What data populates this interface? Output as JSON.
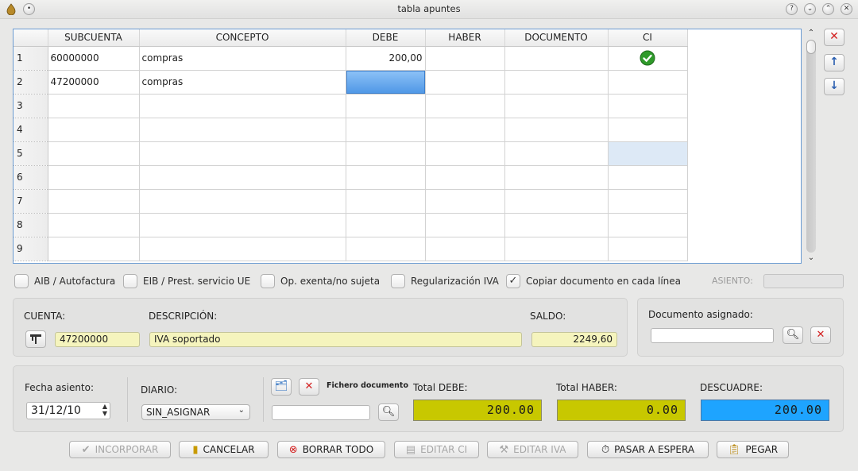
{
  "window": {
    "title": "tabla apuntes"
  },
  "grid": {
    "columns": [
      "SUBCUENTA",
      "CONCEPTO",
      "DEBE",
      "HABER",
      "DOCUMENTO",
      "CI"
    ],
    "rows": [
      {
        "n": "1",
        "subcuenta": "60000000",
        "concepto": "compras",
        "debe": "200,00",
        "haber": "",
        "documento": "",
        "ci": "check"
      },
      {
        "n": "2",
        "subcuenta": "47200000",
        "concepto": "compras",
        "debe": "",
        "haber": "",
        "documento": "",
        "ci": ""
      },
      {
        "n": "3",
        "subcuenta": "",
        "concepto": "",
        "debe": "",
        "haber": "",
        "documento": "",
        "ci": ""
      },
      {
        "n": "4",
        "subcuenta": "",
        "concepto": "",
        "debe": "",
        "haber": "",
        "documento": "",
        "ci": ""
      },
      {
        "n": "5",
        "subcuenta": "",
        "concepto": "",
        "debe": "",
        "haber": "",
        "documento": "",
        "ci": ""
      },
      {
        "n": "6",
        "subcuenta": "",
        "concepto": "",
        "debe": "",
        "haber": "",
        "documento": "",
        "ci": ""
      },
      {
        "n": "7",
        "subcuenta": "",
        "concepto": "",
        "debe": "",
        "haber": "",
        "documento": "",
        "ci": ""
      },
      {
        "n": "8",
        "subcuenta": "",
        "concepto": "",
        "debe": "",
        "haber": "",
        "documento": "",
        "ci": ""
      },
      {
        "n": "9",
        "subcuenta": "",
        "concepto": "",
        "debe": "",
        "haber": "",
        "documento": "",
        "ci": ""
      }
    ]
  },
  "checkboxes": [
    {
      "label": "AIB / Autofactura",
      "checked": false
    },
    {
      "label": "EIB / Prest. servicio UE",
      "checked": false
    },
    {
      "label": "Op. exenta/no sujeta",
      "checked": false
    },
    {
      "label": "Regularización IVA",
      "checked": false
    },
    {
      "label": "Copiar documento en cada línea",
      "checked": true
    }
  ],
  "asiento": {
    "label": "ASIENTO:",
    "value": ""
  },
  "cuenta": {
    "cuenta_label": "CUENTA:",
    "descripcion_label": "DESCRIPCIÓN:",
    "saldo_label": "SALDO:",
    "cuenta_value": "47200000",
    "descripcion_value": "IVA soportado",
    "saldo_value": "2249,60"
  },
  "documento": {
    "label": "Documento asignado:",
    "value": ""
  },
  "asiento_info": {
    "fecha_label": "Fecha asiento:",
    "fecha_value": "31/12/10",
    "diario_label": "DIARIO:",
    "diario_value": "SIN_ASIGNAR",
    "fichero_label": "Fichero documento",
    "fichero_value": ""
  },
  "totals": {
    "debe_label": "Total DEBE:",
    "haber_label": "Total HABER:",
    "descuadre_label": "DESCUADRE:",
    "debe_value": "200.00",
    "haber_value": "0.00",
    "descuadre_value": "200.00"
  },
  "actions": {
    "incorporar": "INCORPORAR",
    "cancelar": "CANCELAR",
    "borrar": "BORRAR TODO",
    "editar_ci": "EDITAR CI",
    "editar_iva": "EDITAR IVA",
    "espera": "PASAR A ESPERA",
    "pegar": "PEGAR"
  },
  "colors": {
    "accent_blue": "#1ea4ff",
    "total_yellow": "#c8c800",
    "field_yellow": "#f5f4bd",
    "danger_red": "#d32020"
  },
  "icons": {
    "window": [
      "app-icon",
      "help-icon",
      "minimize-icon",
      "maximize-icon",
      "close-icon"
    ],
    "side": [
      "delete-row-icon",
      "move-up-icon",
      "move-down-icon"
    ],
    "ci_check": "check-circle-icon"
  }
}
